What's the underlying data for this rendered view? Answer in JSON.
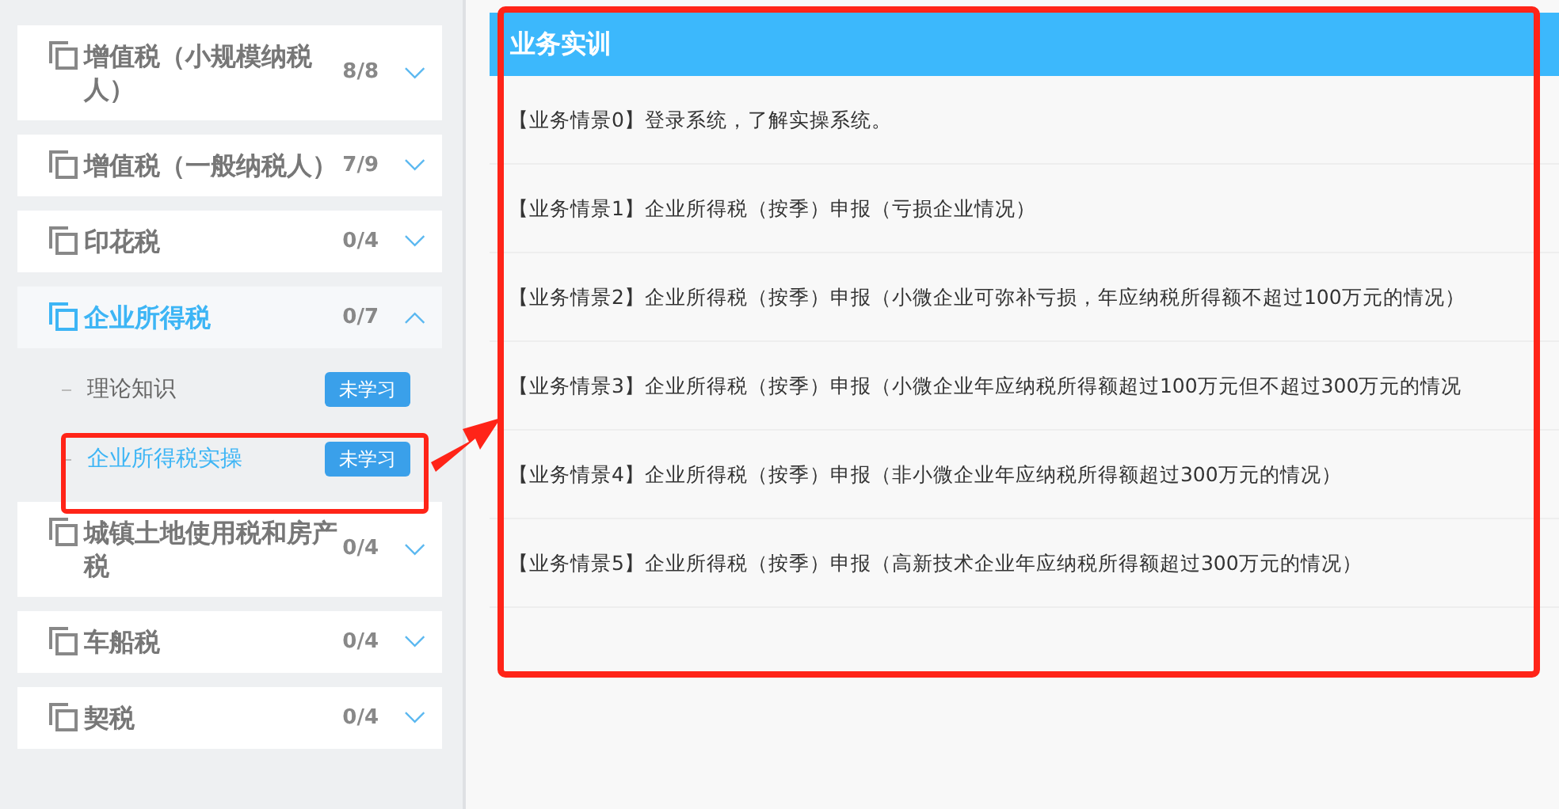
{
  "sidebar": {
    "groups": [
      {
        "title": "增值税（小规模纳税人）",
        "progress": "8/8",
        "expanded": false,
        "selected": false
      },
      {
        "title": "增值税（一般纳税人）",
        "progress": "7/9",
        "expanded": false,
        "selected": false
      },
      {
        "title": "印花税",
        "progress": "0/4",
        "expanded": false,
        "selected": false
      },
      {
        "title": "企业所得税",
        "progress": "0/7",
        "expanded": true,
        "selected": true,
        "children": [
          {
            "label": "理论知识",
            "status": "未学习",
            "selected": false
          },
          {
            "label": "企业所得税实操",
            "status": "未学习",
            "selected": true
          }
        ]
      },
      {
        "title": "城镇土地使用税和房产税",
        "progress": "0/4",
        "expanded": false,
        "selected": false
      },
      {
        "title": "车船税",
        "progress": "0/4",
        "expanded": false,
        "selected": false
      },
      {
        "title": "契税",
        "progress": "0/4",
        "expanded": false,
        "selected": false
      }
    ]
  },
  "panel": {
    "title": "业务实训",
    "items": [
      "【业务情景0】登录系统，了解实操系统。",
      "【业务情景1】企业所得税（按季）申报（亏损企业情况）",
      "【业务情景2】企业所得税（按季）申报（小微企业可弥补亏损，年应纳税所得额不超过100万元的情况）",
      "【业务情景3】企业所得税（按季）申报（小微企业年应纳税所得额超过100万元但不超过300万元的情况",
      "【业务情景4】企业所得税（按季）申报（非小微企业年应纳税所得额超过300万元的情况）",
      "【业务情景5】企业所得税（按季）申报（高新技术企业年应纳税所得额超过300万元的情况）"
    ]
  }
}
